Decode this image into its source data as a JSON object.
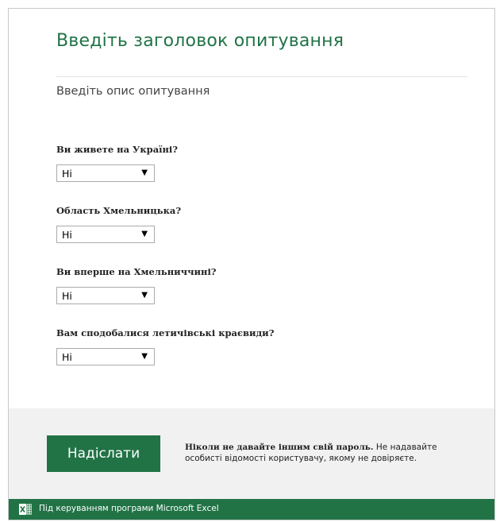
{
  "survey": {
    "title": "Введіть заголовок опитування",
    "description": "Введіть опис опитування"
  },
  "questions": [
    {
      "label": "Ви живете на Україні?",
      "value": "Ні"
    },
    {
      "label": "Область Хмельницька?",
      "value": "Ні"
    },
    {
      "label": "Ви вперше на Хмельниччині?",
      "value": "Ні"
    },
    {
      "label": "Вам сподобалися летичівські краєвиди?",
      "value": "Ні"
    }
  ],
  "dropdown_arrow": "▼",
  "submit": {
    "label": "Надіслати"
  },
  "notice": {
    "bold": "Ніколи не давайте іншим свій пароль.",
    "text": "Не надавайте особисті відомості користувачу, якому не довіряєте."
  },
  "footer": {
    "icon": "excel-icon",
    "text": "Під керуванням програми Microsoft Excel"
  },
  "colors": {
    "accent": "#217346",
    "bottom_panel": "#f1f1f1"
  }
}
